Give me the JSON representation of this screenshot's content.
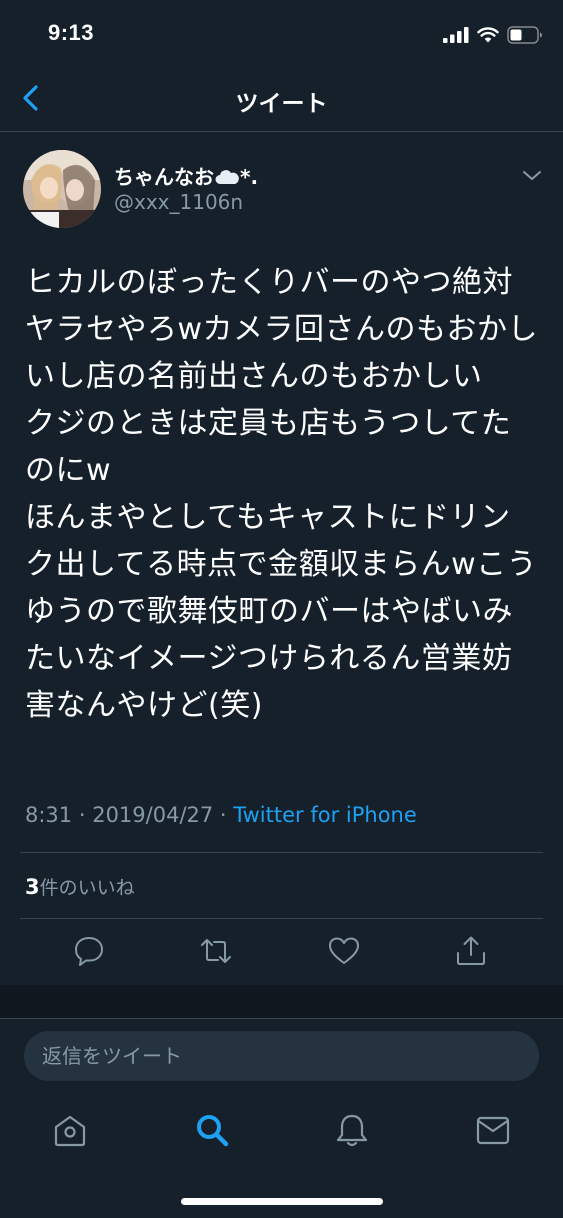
{
  "status": {
    "time": "9:13"
  },
  "nav": {
    "title": "ツイート"
  },
  "tweet": {
    "display_name": "ちゃんなお",
    "name_suffix": "*.",
    "username": "@xxx_1106n",
    "text": "ヒカルのぼったくりバーのやつ絶対ヤラセやろwカメラ回さんのもおかしいし店の名前出さんのもおかしい\nクジのときは定員も店もうつしてたのにw\nほんまやとしてもキャストにドリンク出してる時点で金額収まらんwこうゆうので歌舞伎町のバーはやばいみたいなイメージつけられるん営業妨害なんやけど(笑)",
    "time": "8:31",
    "date": "2019/04/27",
    "separator": " · ",
    "source": "Twitter for iPhone",
    "likes_count": "3",
    "likes_label": "件のいいね"
  },
  "reply": {
    "placeholder": "返信をツイート"
  },
  "icons": {
    "back": "chevron-left-icon",
    "caret": "chevron-down-icon",
    "reply": "reply-icon",
    "retweet": "retweet-icon",
    "like": "heart-icon",
    "share": "share-icon",
    "home": "home-icon",
    "search": "search-icon",
    "notifications": "bell-icon",
    "messages": "mail-icon"
  },
  "colors": {
    "background": "#15202b",
    "accent": "#1da1f2",
    "secondary_text": "#8899a6",
    "divider": "#38444d",
    "input_bg": "#253341"
  }
}
